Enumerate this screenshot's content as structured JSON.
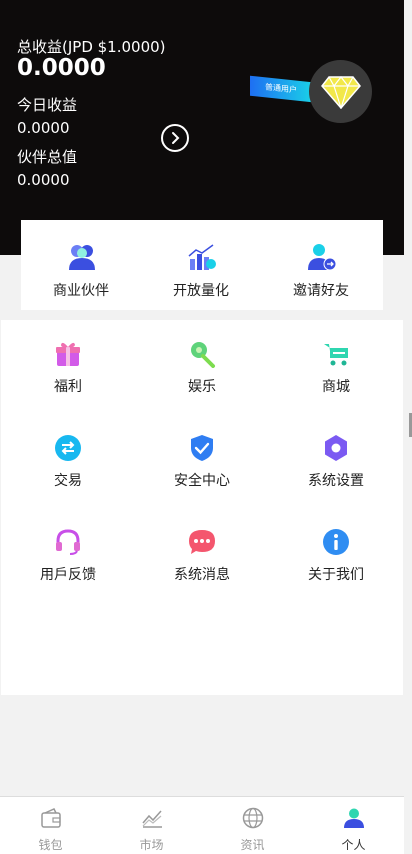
{
  "header": {
    "total_label": "总收益(JPD $1.0000)",
    "total_value": "0.0000",
    "today_label": "今日收益",
    "today_value": "0.0000",
    "partner_label": "伙伴总值",
    "partner_value": "0.0000",
    "member_badge": "普通用户",
    "colors": {
      "background": "#0d0b0b",
      "diamond": "#f2e84a",
      "ribbon": "#1e6ff2"
    }
  },
  "top_card": {
    "items": [
      {
        "label": "商业伙伴",
        "icon": "partners-icon"
      },
      {
        "label": "开放量化",
        "icon": "quant-chart-icon"
      },
      {
        "label": "邀请好友",
        "icon": "invite-friend-icon"
      }
    ]
  },
  "grid": {
    "items": [
      {
        "label": "福利",
        "icon": "gift-icon"
      },
      {
        "label": "娱乐",
        "icon": "entertainment-icon"
      },
      {
        "label": "商城",
        "icon": "cart-icon"
      },
      {
        "label": "交易",
        "icon": "exchange-icon"
      },
      {
        "label": "安全中心",
        "icon": "shield-icon"
      },
      {
        "label": "系统设置",
        "icon": "settings-hexagon-icon"
      },
      {
        "label": "用戶反馈",
        "icon": "headset-icon"
      },
      {
        "label": "系统消息",
        "icon": "message-icon"
      },
      {
        "label": "关于我们",
        "icon": "info-icon"
      }
    ]
  },
  "tabbar": {
    "tabs": [
      {
        "label": "钱包",
        "icon": "wallet-icon"
      },
      {
        "label": "市场",
        "icon": "market-icon"
      },
      {
        "label": "资讯",
        "icon": "globe-icon"
      },
      {
        "label": "个人",
        "icon": "user-icon",
        "active": true
      }
    ]
  }
}
